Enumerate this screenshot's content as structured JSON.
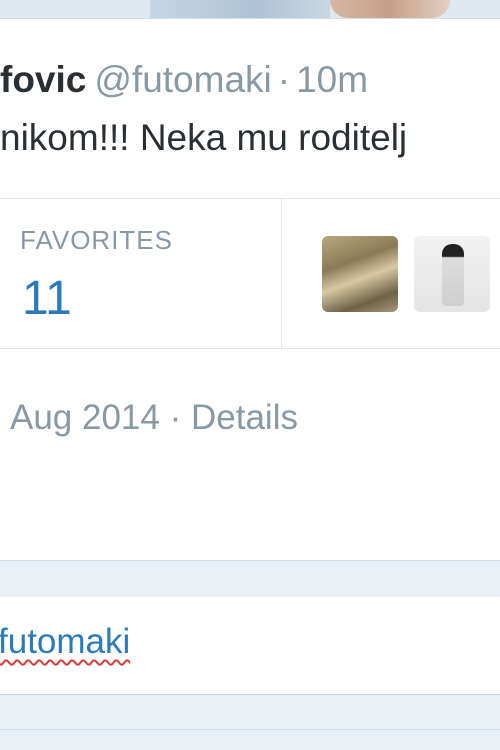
{
  "tweet": {
    "name": "fovic",
    "handle": "@futomaki",
    "separator": "·",
    "time": "10m",
    "text": "nikom!!! Neka mu roditelj"
  },
  "stats": {
    "favorites_label": "FAVORITES",
    "favorites_count": "11"
  },
  "meta": {
    "date": "Aug 2014",
    "separator": "·",
    "details_label": "Details"
  },
  "reply": {
    "text": "futomaki"
  },
  "colors": {
    "link_blue": "#2b7bb9",
    "muted_gray": "#8899a6",
    "text_dark": "#292f33"
  }
}
